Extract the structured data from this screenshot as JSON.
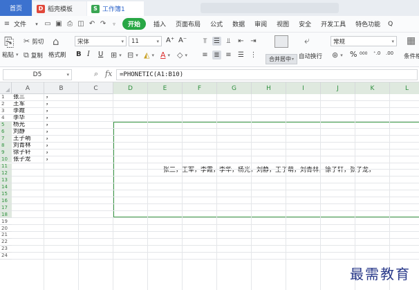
{
  "tabs": {
    "home": "首页",
    "templates": "稻壳模板",
    "workbook": "工作簿1"
  },
  "menu": {
    "file": "文件",
    "start": "开始",
    "items": [
      "插入",
      "页面布局",
      "公式",
      "数据",
      "审阅",
      "视图",
      "安全",
      "开发工具",
      "特色功能"
    ],
    "search_icon": "Q"
  },
  "ribbon": {
    "cut": "剪切",
    "paste": "粘贴",
    "copy": "复制",
    "format_painter": "格式刷",
    "font_name": "宋体",
    "font_size": "11",
    "grow_font": "A⁺",
    "shrink_font": "A⁻",
    "bold": "B",
    "italic": "I",
    "underline": "U",
    "merge_center": "合并居中",
    "wrap_text": "自动换行",
    "number_format": "常规",
    "percent": "%",
    "thousands": "000",
    "conditional_format": "条件格"
  },
  "formula_bar": {
    "cell_ref": "D5",
    "fx": "fx",
    "formula": "=PHONETIC(A1:B10)"
  },
  "grid": {
    "columns": [
      "A",
      "B",
      "C",
      "D",
      "E",
      "F",
      "G",
      "H",
      "I",
      "J",
      "K",
      "L"
    ],
    "selected_columns": [
      "D",
      "E",
      "F",
      "G",
      "H",
      "I",
      "J",
      "K",
      "L"
    ],
    "rows": [
      "1",
      "2",
      "3",
      "4",
      "5",
      "6",
      "7",
      "8",
      "9",
      "10",
      "11",
      "12",
      "13",
      "14",
      "15",
      "16",
      "17",
      "18",
      "19",
      "20",
      "21",
      "22",
      "23",
      "24"
    ],
    "selected_rows": [
      "5",
      "6",
      "7",
      "8",
      "9",
      "10",
      "11",
      "12",
      "13",
      "14",
      "15",
      "16",
      "17",
      "18"
    ],
    "column_a": [
      "张三",
      "王军",
      "李霞",
      "李华",
      "杨光",
      "刘静",
      "王子萌",
      "刘青林",
      "徐子轩",
      "张子龙"
    ],
    "column_b": [
      "，",
      "，",
      "，",
      "，",
      "，",
      "，",
      "，",
      "，",
      "，",
      "，"
    ],
    "merged_result": "张三，王军，李霞，李华，杨光，刘静，王子萌，刘青林，徐子轩，张子龙，"
  },
  "watermark": "最需教育",
  "colors": {
    "accent_blue": "#3c72cf",
    "accent_green": "#3d9a46",
    "start_green": "#28a745"
  }
}
